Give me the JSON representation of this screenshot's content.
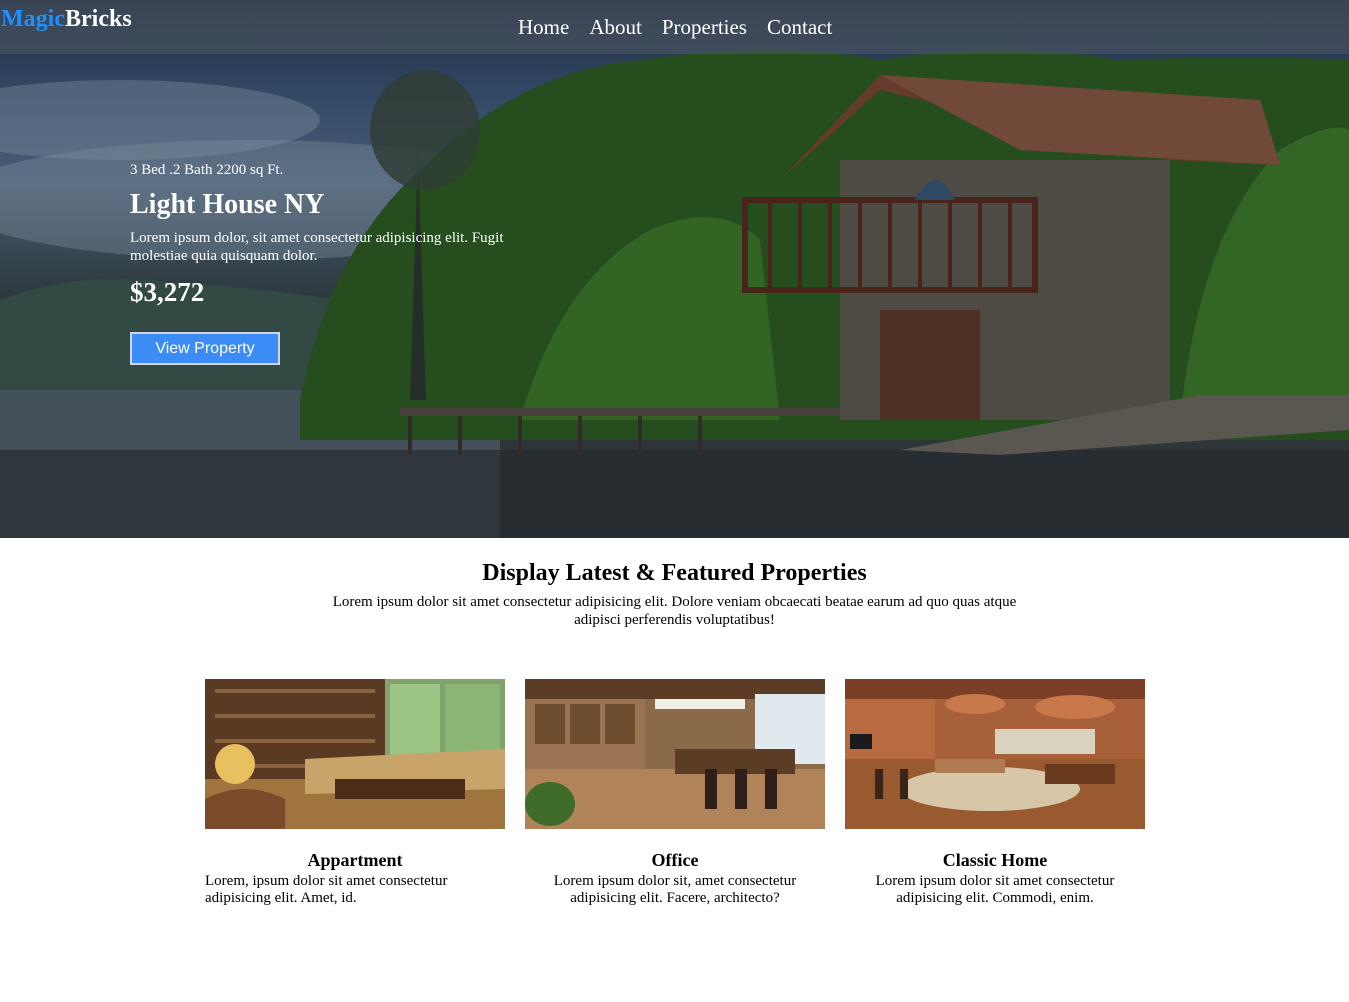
{
  "brand": {
    "part1": "Magic",
    "part2": "Bricks"
  },
  "nav": {
    "items": [
      "Home",
      "About",
      "Properties",
      "Contact"
    ]
  },
  "hero": {
    "meta": "3 Bed .2 Bath 2200 sq Ft.",
    "title": "Light House NY",
    "description": "Lorem ipsum dolor, sit amet consectetur adipisicing elit. Fugit molestiae quia quisquam dolor.",
    "price": "$3,272",
    "button": "View Property"
  },
  "section": {
    "title": "Display Latest & Featured Properties",
    "description": "Lorem ipsum dolor sit amet consectetur adipisicing elit. Dolore veniam obcaecati beatae earum ad quo quas atque adipisci perferendis voluptatibus!"
  },
  "cards": [
    {
      "title": "Appartment",
      "description": "Lorem, ipsum dolor sit amet consectetur adipisicing elit. Amet, id."
    },
    {
      "title": "Office",
      "description": "Lorem ipsum dolor sit, amet consectetur adipisicing elit. Facere, architecto?"
    },
    {
      "title": "Classic Home",
      "description": "Lorem ipsum dolor sit amet consectetur adipisicing elit. Commodi, enim."
    }
  ],
  "colors": {
    "brand_blue": "#1e90ff",
    "button_blue": "#3b8cf6"
  }
}
